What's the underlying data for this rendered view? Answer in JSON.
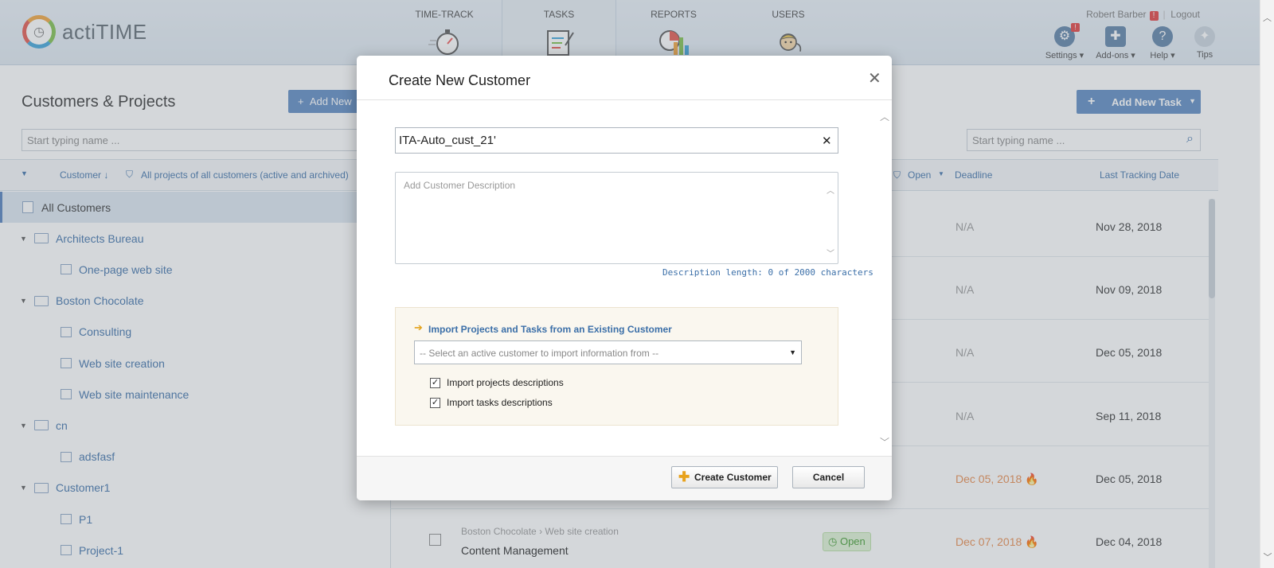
{
  "app": {
    "name": "actiTIME"
  },
  "nav": {
    "tabs": [
      {
        "label": "TIME-TRACK",
        "icon": "stopwatch-icon"
      },
      {
        "label": "TASKS",
        "icon": "clipboard-icon"
      },
      {
        "label": "REPORTS",
        "icon": "chart-icon"
      },
      {
        "label": "USERS",
        "icon": "user-icon"
      }
    ],
    "user_name": "Robert Barber",
    "user_warning": "!",
    "logout": "Logout",
    "settings_badge": "!",
    "settings": "Settings ▾",
    "addons": "Add-ons ▾",
    "help": "Help ▾",
    "tips": "Tips"
  },
  "left": {
    "title": "Customers & Projects",
    "add_new": "Add New",
    "search_placeholder": "Start typing name ...",
    "sort_label": "Customer ↓",
    "filter_label": "All projects of all customers (active and archived)",
    "tree": [
      {
        "label": "All Customers",
        "level": 0
      },
      {
        "label": "Architects Bureau",
        "level": 1
      },
      {
        "label": "One-page web site",
        "level": 2
      },
      {
        "label": "Boston Chocolate",
        "level": 1
      },
      {
        "label": "Consulting",
        "level": 2
      },
      {
        "label": "Web site creation",
        "level": 2
      },
      {
        "label": "Web site maintenance",
        "level": 2
      },
      {
        "label": "cn",
        "level": 1
      },
      {
        "label": "adsfasf",
        "level": 2
      },
      {
        "label": "Customer1",
        "level": 1
      },
      {
        "label": "P1",
        "level": 2
      },
      {
        "label": "Project-1",
        "level": 2
      }
    ]
  },
  "right": {
    "add_task": "Add New Task",
    "search_placeholder": "Start typing name ...",
    "col_status": "Open",
    "col_deadline": "Deadline",
    "col_last_tracking": "Last Tracking Date",
    "rows": [
      {
        "deadline": "N/A",
        "last": "Nov 28, 2018"
      },
      {
        "deadline": "N/A",
        "last": "Nov 09, 2018"
      },
      {
        "deadline": "N/A",
        "last": "Dec 05, 2018"
      },
      {
        "deadline": "N/A",
        "last": "Sep 11, 2018"
      },
      {
        "deadline": "Dec 05, 2018",
        "last": "Dec 05, 2018"
      }
    ],
    "last_row": {
      "breadcrumb_customer": "Boston Chocolate",
      "breadcrumb_project": "Web site creation",
      "task": "Content Management",
      "status": "Open",
      "deadline": "Dec 07, 2018",
      "last": "Dec 04, 2018"
    }
  },
  "modal": {
    "title": "Create New Customer",
    "name_value": "ITA-Auto_cust_21'",
    "description_placeholder": "Add Customer Description",
    "description_count": "Description length: 0 of 2000 characters",
    "import_title": "Import Projects and Tasks from an Existing Customer",
    "import_select_placeholder": "-- Select an active customer to import information from --",
    "import_projects_desc": "Import projects descriptions",
    "import_projects_checked": true,
    "import_tasks_desc": "Import tasks descriptions",
    "import_tasks_checked": true,
    "create_button": "Create Customer",
    "cancel_button": "Cancel"
  }
}
